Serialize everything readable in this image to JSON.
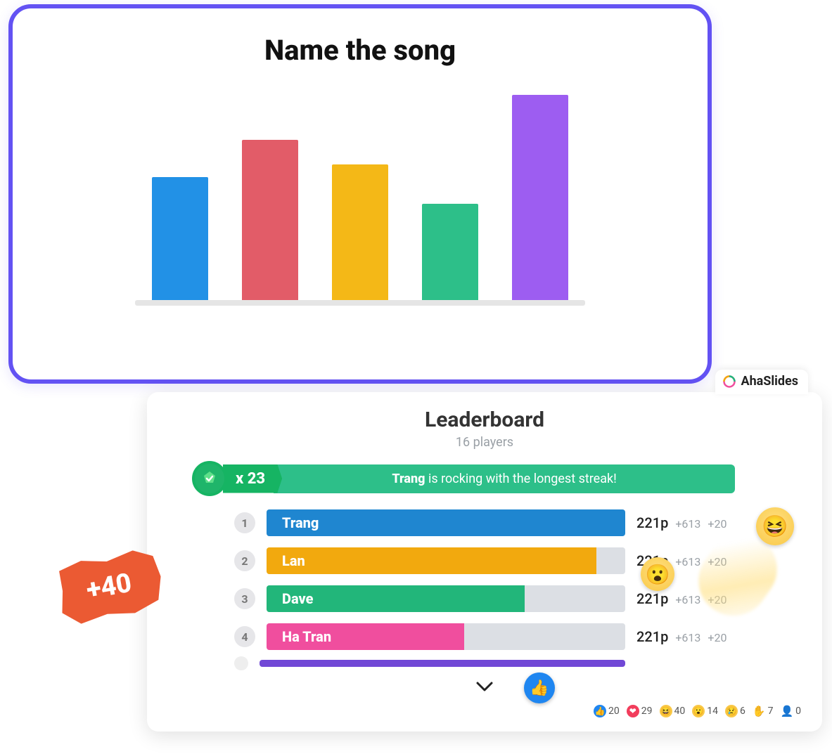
{
  "chart_data": {
    "type": "bar",
    "title": "Name the song",
    "categories": [
      "",
      "",
      "",
      "",
      ""
    ],
    "values": [
      60,
      78,
      66,
      47,
      100
    ],
    "colors": [
      "#2291e6",
      "#e25c68",
      "#f4b817",
      "#2dbf89",
      "#9d5df1"
    ],
    "xlabel": "",
    "ylabel": "",
    "ylim": [
      0,
      100
    ]
  },
  "brand": {
    "name": "AhaSlides"
  },
  "leaderboard": {
    "title": "Leaderboard",
    "subtitle": "16 players",
    "streak": {
      "multiplier": "x 23",
      "player": "Trang",
      "message_suffix": " is rocking with the longest streak!"
    },
    "rows": [
      {
        "rank": "1",
        "name": "Trang",
        "points": "221p",
        "delta1": "+613",
        "delta2": "+20",
        "color": "#1f86d0",
        "fill": 100
      },
      {
        "rank": "2",
        "name": "Lan",
        "points": "221p",
        "delta1": "+613",
        "delta2": "+20",
        "color": "#f2a90e",
        "fill": 92
      },
      {
        "rank": "3",
        "name": "Dave",
        "points": "221p",
        "delta1": "+613",
        "delta2": "+20",
        "color": "#22b67a",
        "fill": 72
      },
      {
        "rank": "4",
        "name": "Ha Tran",
        "points": "221p",
        "delta1": "+613",
        "delta2": "+20",
        "color": "#f04e9e",
        "fill": 55
      }
    ]
  },
  "bonus": {
    "label": "+40"
  },
  "reactions": {
    "like": "20",
    "heart": "29",
    "laugh": "40",
    "wow": "14",
    "sad": "6",
    "hand": "7",
    "user": "0"
  }
}
